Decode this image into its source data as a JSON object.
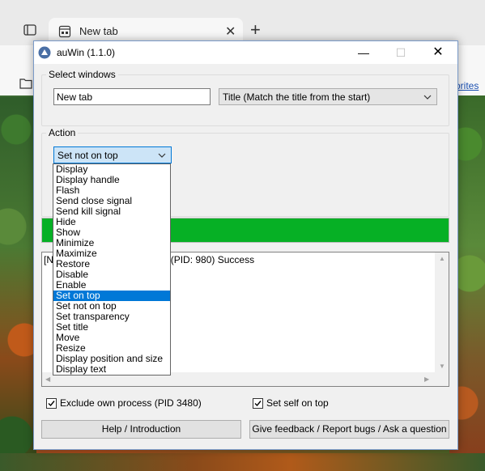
{
  "browser": {
    "tab_title": "New tab",
    "new_tab_symbol": "+",
    "close_symbol": "✕",
    "favorites_label": "vorites"
  },
  "window": {
    "title": "auWin (1.1.0)",
    "min_symbol": "—",
    "max_symbol": "☐",
    "close_symbol": "✕"
  },
  "select_windows": {
    "label": "Select windows",
    "title_value": "New tab",
    "match_mode": "Title (Match the title from the start)"
  },
  "action": {
    "label": "Action",
    "selected": "Set not on top",
    "options": [
      "Display",
      "Display handle",
      "Flash",
      "Send close signal",
      "Send kill signal",
      "Hide",
      "Show",
      "Minimize",
      "Maximize",
      "Restore",
      "Disable",
      "Enable",
      "Set on top",
      "Set not on top",
      "Set transparency",
      "Set title",
      "Move",
      "Resize",
      "Display position and size",
      "Display text"
    ],
    "highlighted_index": 12
  },
  "progress": {
    "value_percent": 100,
    "color": "#06b025"
  },
  "log": {
    "line_prefix": "[Ne",
    "line_suffix": "ge] (PID: 980) Success"
  },
  "options": {
    "exclude_own_label": "Exclude own process (PID 3480)",
    "exclude_own_checked": true,
    "self_on_top_label": "Set self on top",
    "self_on_top_checked": true
  },
  "buttons": {
    "help": "Help / Introduction",
    "feedback": "Give feedback / Report bugs / Ask a question"
  },
  "colors": {
    "accent": "#0078d7",
    "progress": "#06b025"
  }
}
